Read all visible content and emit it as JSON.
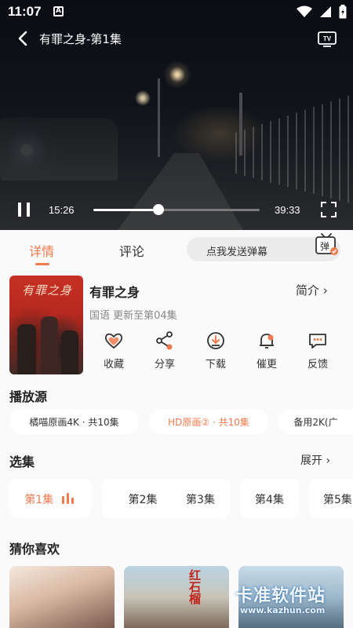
{
  "status_bar": {
    "time": "11:07",
    "indicator": "A"
  },
  "player": {
    "title": "有罪之身-第1集",
    "current_time": "15:26",
    "total_time": "39:33",
    "progress_fraction": 0.39
  },
  "tabs": {
    "detail": "详情",
    "comments": "评论",
    "danmaku_placeholder": "点我发送弹幕",
    "danmaku_icon_label": "弹"
  },
  "show": {
    "poster_title": "有罪之身",
    "name": "有罪之身",
    "intro_label": "简介",
    "meta": "国语  更新至第04集",
    "actions": [
      {
        "label": "收藏",
        "icon": "heart-icon"
      },
      {
        "label": "分享",
        "icon": "share-icon"
      },
      {
        "label": "下载",
        "icon": "download-icon"
      },
      {
        "label": "催更",
        "icon": "bell-icon"
      },
      {
        "label": "反馈",
        "icon": "feedback-icon"
      }
    ]
  },
  "sources": {
    "title": "播放源",
    "items": [
      "橘喵原画4K · 共10集",
      "HD原画② · 共10集",
      "备用2K(广"
    ],
    "selected_index": 1
  },
  "episodes": {
    "title": "选集",
    "expand_label": "展开",
    "items": [
      "第1集",
      "第2集",
      "第3集",
      "第4集",
      "第5集"
    ],
    "selected_index": 0
  },
  "recommend": {
    "title": "猜你喜欢",
    "poster_text": "红石榴"
  },
  "watermark": {
    "text": "卡准软件站",
    "url": "www.kazhun.com"
  },
  "colors": {
    "accent": "#f07a4c",
    "player_bg": "#0a0c12",
    "content_bg": "#fafafa"
  }
}
